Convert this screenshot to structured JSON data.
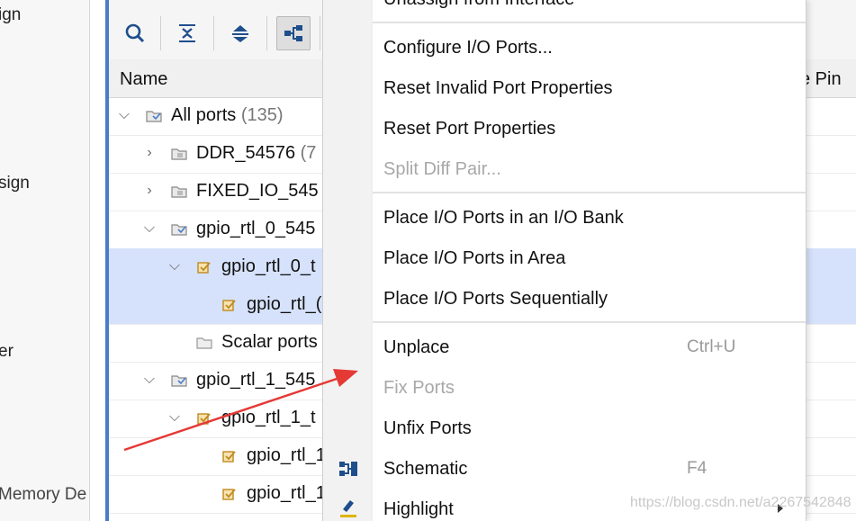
{
  "left_nav": {
    "items": [
      "ign",
      "sign",
      "er",
      "Memory De"
    ]
  },
  "tree": {
    "header_name": "Name",
    "header_pin": "e Pin",
    "rows": [
      {
        "label": "All ports",
        "count": "(135)"
      },
      {
        "label": "DDR_54576",
        "count": "(7"
      },
      {
        "label": "FIXED_IO_545",
        "count": ""
      },
      {
        "label": "gpio_rtl_0_545",
        "count": ""
      },
      {
        "label": "gpio_rtl_0_t",
        "count": ""
      },
      {
        "label": "gpio_rtl_(",
        "count": ""
      },
      {
        "label": "Scalar ports",
        "count": ""
      },
      {
        "label": "gpio_rtl_1_545",
        "count": ""
      },
      {
        "label": "gpio_rtl_1_t",
        "count": ""
      },
      {
        "label": "gpio_rtl_1",
        "count": ""
      },
      {
        "label": "gpio_rtl_1",
        "count": ""
      }
    ]
  },
  "context_menu": {
    "top_partial": "Unassign from Interface",
    "configure": "Configure I/O Ports...",
    "reset_invalid": "Reset Invalid Port Properties",
    "reset_props": "Reset Port Properties",
    "split_diff": "Split Diff Pair...",
    "place_bank": "Place I/O Ports in an I/O Bank",
    "place_area": "Place I/O Ports in Area",
    "place_seq": "Place I/O Ports Sequentially",
    "unplace": "Unplace",
    "unplace_shortcut": "Ctrl+U",
    "fix_ports": "Fix Ports",
    "unfix_ports": "Unfix Ports",
    "schematic": "Schematic",
    "schematic_shortcut": "F4",
    "highlight": "Highlight"
  },
  "watermark": "https://blog.csdn.net/a2267542848",
  "colors": {
    "selection": "#d6e2fb",
    "accent_blue": "#4a7cc9",
    "arrow_red": "#e53935",
    "disabled": "#a8a8a8"
  }
}
